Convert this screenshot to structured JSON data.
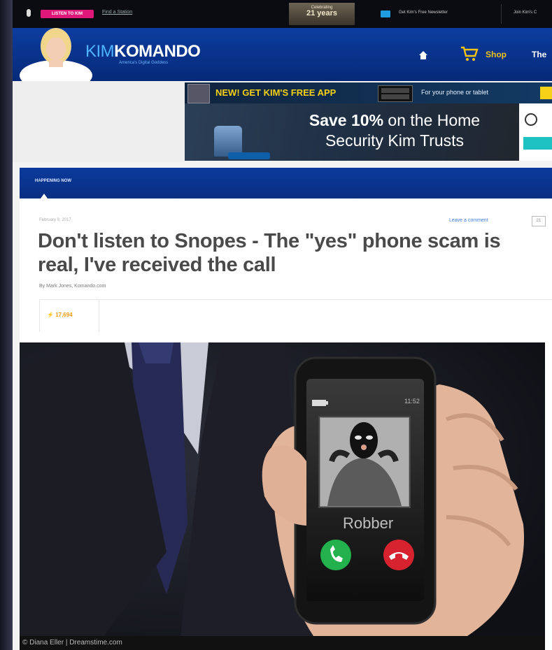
{
  "topbar": {
    "listen_label": "LISTEN TO KIM",
    "find_station": "Find a Station",
    "anniversary_top": "Celebrating",
    "anniversary_main": "21 years",
    "newsletter": "Get Kim's Free Newsletter",
    "join": "Join Kim's C"
  },
  "header": {
    "logo_kim": "KIM",
    "logo_komando": "KOMANDO",
    "tagline": "America's Digital Goddess",
    "shop": "Shop",
    "the": "The",
    "accent": "#f3c316"
  },
  "ad": {
    "banner_new": "NEW! GET KIM'S FREE APP",
    "banner_phone": "For your phone or tablet",
    "headline_bold": "Save 10%",
    "headline_rest": " on the Home",
    "headline_line2": "Security Kim Trusts"
  },
  "happening": {
    "label": "HAPPENING NOW"
  },
  "article": {
    "date": "February 9, 2017",
    "leave_comment": "Leave a comment",
    "comment_count": "21",
    "title": "Don't listen to Snopes - The \"yes\" phone scam is real, I've received the call",
    "byline": "By Mark Jones, Komando.com",
    "share_count": "17,694"
  },
  "photo": {
    "caller_name": "Robber",
    "clock": "11:52",
    "credit": "© Diana Eller | Dreamstime.com"
  }
}
